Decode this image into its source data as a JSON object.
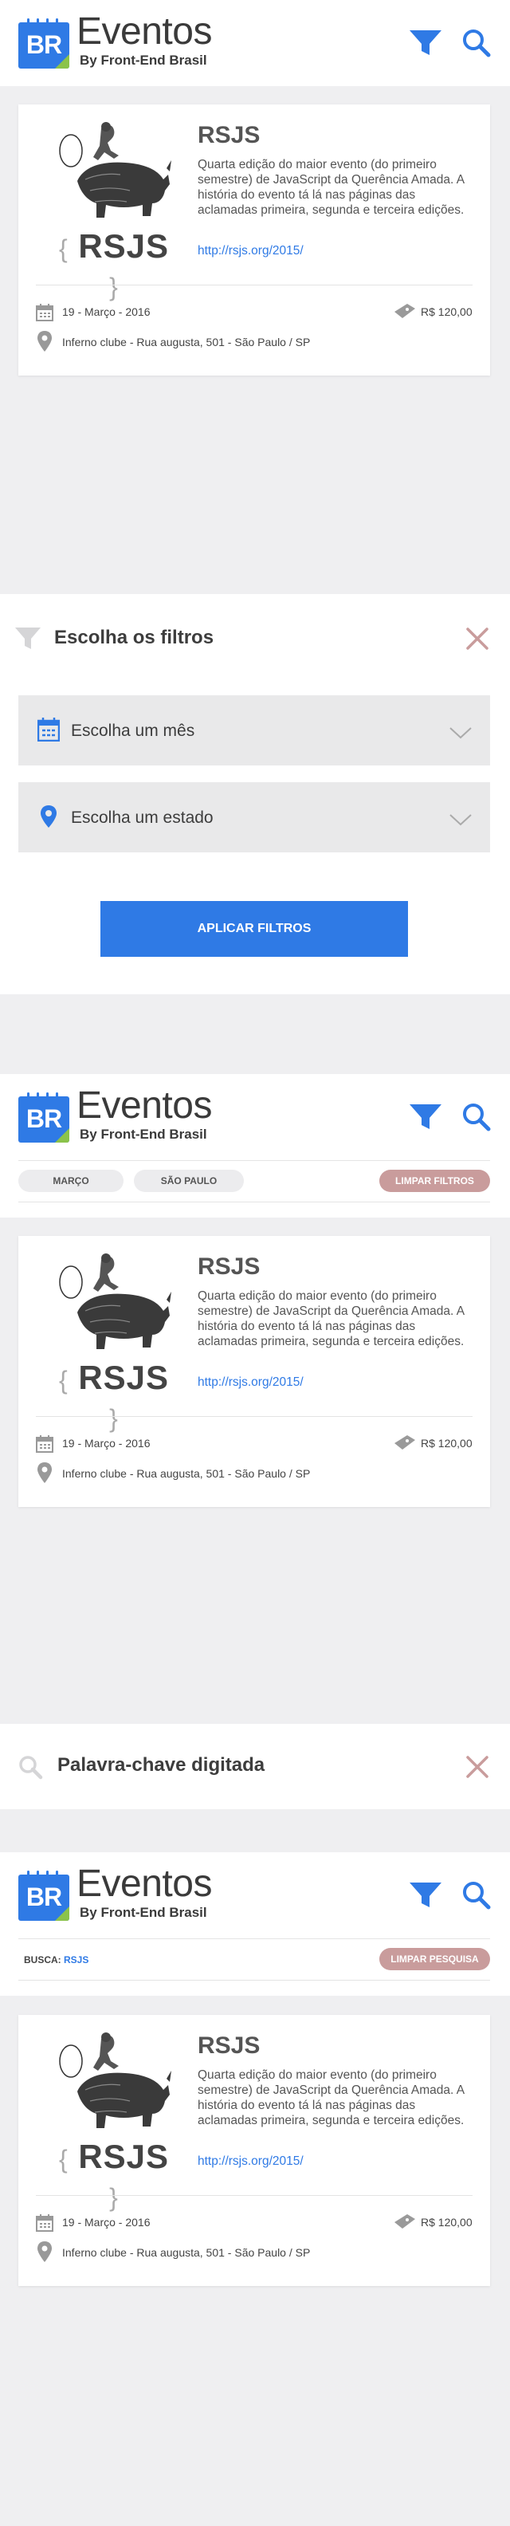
{
  "header": {
    "logo_text": "BR",
    "title": "Eventos",
    "subtitle": "By Front-End Brasil",
    "icons": [
      "filter-icon",
      "search-icon"
    ]
  },
  "event": {
    "logo_text": "RSJS",
    "title": "RSJS",
    "description": "Quarta edição do maior evento (do primeiro semestre) de JavaScript da Querência Amada. A história do evento tá lá nas páginas das aclamadas primeira, segunda e terceira edições.",
    "link": "http://rsjs.org/2015/",
    "date": "19 - Março - 2016",
    "price": "R$ 120,00",
    "place": "Inferno clube - Rua augusta, 501 - São Paulo / SP"
  },
  "filters_panel": {
    "title": "Escolha os filtros",
    "month_placeholder": "Escolha um mês",
    "state_placeholder": "Escolha um estado",
    "apply_label": "APLICAR FILTROS"
  },
  "active_filters": {
    "chips": [
      "MARÇO",
      "SÃO PAULO"
    ],
    "clear_label": "LIMPAR FILTROS"
  },
  "search_panel": {
    "keyword": "Palavra-chave digitada"
  },
  "active_search": {
    "label": "BUSCA:",
    "value": "RSJS",
    "clear_label": "LIMPAR PESQUISA"
  },
  "colors": {
    "accent": "#2f7ae5",
    "clear": "#c99c9c",
    "background": "#efeff1",
    "logo_green": "#8bc34a"
  }
}
